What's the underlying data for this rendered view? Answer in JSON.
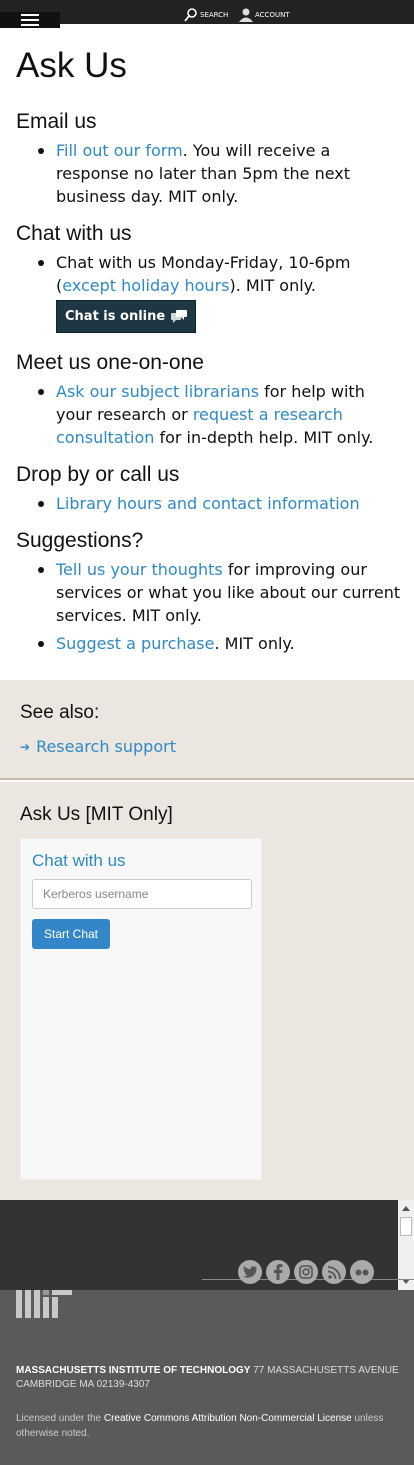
{
  "header": {
    "search_label": "SEARCH",
    "account_label": "ACCOUNT"
  },
  "page": {
    "title": "Ask Us"
  },
  "email": {
    "heading": "Email us",
    "link": "Fill out our form",
    "text": ". You will receive a response no later than 5pm the next business day. MIT only."
  },
  "chat": {
    "heading": "Chat with us",
    "text_before": "Chat with us Monday-Friday, 10-6pm (",
    "link": "except holiday hours",
    "text_after": "). MIT only.",
    "badge": "Chat is online"
  },
  "meet": {
    "heading": "Meet us one-on-one",
    "link1": "Ask our subject librarians",
    "text1": " for help with your research or ",
    "link2": "request a research consultation",
    "text2": " for in-depth help. MIT only."
  },
  "dropby": {
    "heading": "Drop by or call us",
    "link": "Library hours and contact information"
  },
  "suggestions": {
    "heading": "Suggestions?",
    "item1_link": "Tell us your thoughts",
    "item1_text": " for improving our services or what you like about our current services. MIT only.",
    "item2_link": "Suggest a purchase",
    "item2_text": ". MIT only."
  },
  "see_also": {
    "heading": "See also:",
    "link": "Research support"
  },
  "ask_mit": {
    "heading": "Ask Us [MIT Only]",
    "chat_heading": "Chat with us",
    "input_placeholder": "Kerberos username",
    "button": "Start Chat"
  },
  "footer": {
    "socials": [
      "twitter-icon",
      "facebook-icon",
      "instagram-icon",
      "rss-icon",
      "flickr-icon"
    ],
    "institute": "MASSACHUSETTS INSTITUTE OF TECHNOLOGY",
    "address_line1": " 77 MASSACHUSETTS AVENUE",
    "address_line2": "CAMBRIDGE MA 02139-4307",
    "license_before": "Licensed under the ",
    "license_link": "Creative Commons Attribution Non-Commercial License",
    "license_after": " unless otherwise noted."
  },
  "colors": {
    "link": "#2f89c5",
    "badge_bg": "#1f3745",
    "panel_bg": "#ebe6e0",
    "footer_dark": "#333333",
    "footer_gray": "#5a5a5a",
    "button": "#3387c8"
  }
}
